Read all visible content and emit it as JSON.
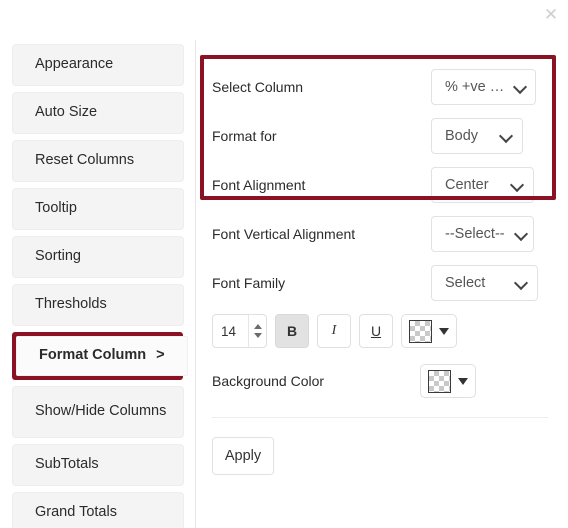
{
  "window": {
    "close_label": "✕"
  },
  "sidebar": {
    "items": [
      {
        "label": "Appearance",
        "selected": false
      },
      {
        "label": "Auto Size",
        "selected": false
      },
      {
        "label": "Reset Columns",
        "selected": false
      },
      {
        "label": "Tooltip",
        "selected": false
      },
      {
        "label": "Sorting",
        "selected": false
      },
      {
        "label": "Thresholds",
        "selected": false
      },
      {
        "label": "Format Column",
        "chevron": ">",
        "selected": true
      },
      {
        "label": "Show/Hide Columns",
        "selected": false
      },
      {
        "label": "SubTotals",
        "selected": false
      },
      {
        "label": "Grand Totals",
        "selected": false
      }
    ]
  },
  "form": {
    "rows": [
      {
        "label": "Select Column",
        "value": "% +ve …"
      },
      {
        "label": "Format for",
        "value": "Body"
      },
      {
        "label": "Font Alignment",
        "value": "Center"
      },
      {
        "label": "Font Vertical Alignment",
        "value": "--Select--"
      },
      {
        "label": "Font Family",
        "value": "Select"
      }
    ],
    "font_toolbar": {
      "size": "14",
      "bold_label": "B",
      "italic_label": "I",
      "underline_label": "U",
      "bold_active": true,
      "font_color": "transparent"
    },
    "background_color_label": "Background Color",
    "background_color": "transparent",
    "apply_label": "Apply"
  },
  "colors": {
    "highlight": "#8b1225",
    "sidebar_item_bg": "#f4f4f4",
    "panel_bg": "#ffffff"
  }
}
